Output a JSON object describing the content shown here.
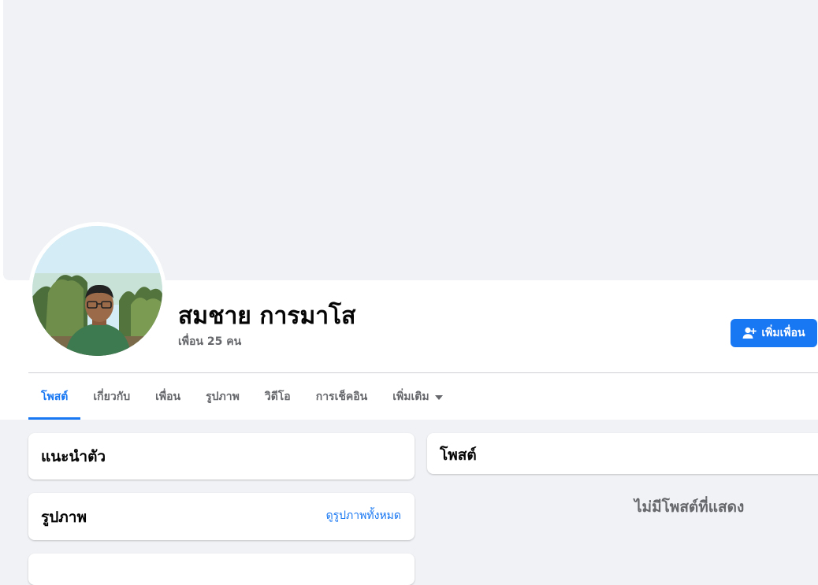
{
  "profile": {
    "name": "สมชาย การมาโส",
    "friends_count": "เพื่อน 25 คน",
    "add_friend_label": "เพิ่มเพื่อน"
  },
  "tabs": [
    {
      "label": "โพสต์",
      "active": true
    },
    {
      "label": "เกี่ยวกับ",
      "active": false
    },
    {
      "label": "เพื่อน",
      "active": false
    },
    {
      "label": "รูปภาพ",
      "active": false
    },
    {
      "label": "วิดีโอ",
      "active": false
    },
    {
      "label": "การเช็คอิน",
      "active": false
    },
    {
      "label": "เพิ่มเติม",
      "active": false
    }
  ],
  "intro": {
    "title": "แนะนำตัว"
  },
  "photos": {
    "title": "รูปภาพ",
    "see_all": "ดูรูปภาพทั้งหมด"
  },
  "posts": {
    "title": "โพสต์",
    "empty_text": "ไม่มีโพสต์ที่แสดง"
  },
  "colors": {
    "accent": "#1877f2",
    "background": "#f0f2f5",
    "secondary_text": "#65676b"
  }
}
